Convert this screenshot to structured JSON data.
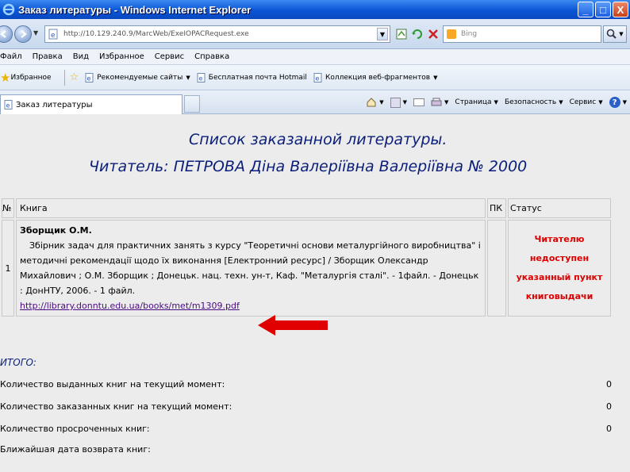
{
  "window": {
    "title": "Заказ литературы - Windows Internet Explorer",
    "buttons": {
      "minimize": "_",
      "maximize": "□",
      "close": "X"
    }
  },
  "address_bar": {
    "url": "http://10.129.240.9/MarcWeb/ExeIOPACRequest.exe",
    "search_placeholder": "Bing"
  },
  "menu": [
    "Файл",
    "Правка",
    "Вид",
    "Избранное",
    "Сервис",
    "Справка"
  ],
  "favorites": {
    "label": "Избранное",
    "items": [
      "Рекомендуемые сайты",
      "Бесплатная почта Hotmail",
      "Коллекция веб-фрагментов"
    ]
  },
  "tab": {
    "label": "Заказ литературы"
  },
  "command_bar": {
    "page": "Страница",
    "safety": "Безопасность",
    "tools": "Сервис"
  },
  "content": {
    "heading1": "Список заказанной литературы.",
    "heading2": "Читатель: ПЕТРОВА Діна Валеріївна Валеріївна   № 2000",
    "table": {
      "headers": {
        "num": "№",
        "book": "Книга",
        "pk": "ПК",
        "status": "Статус"
      },
      "rows": [
        {
          "num": "1",
          "author": "Зборщик О.М.",
          "description": "Збірник задач для практичних занять з курсу \"Теоретичні основи металургійного виробництва\" і методичні рекомендації щодо їх виконання [Електронний ресурс] / Зборщик Олександр Михайлович ; О.М. Зборщик ; Донецьк. нац. техн. ун-т, Каф. \"Металургія сталі\". - 1файл. - Донецьк : ДонНТУ, 2006. - 1 файл.",
          "link": "http://library.donntu.edu.ua/books/met/m1309.pdf",
          "pk": "",
          "status": "Читателю недоступен указанный пункт книговыдачи"
        }
      ]
    },
    "summary_title": "ИТОГО:",
    "summary": [
      {
        "label": "Количество выданных книг на текущий момент:",
        "value": "0"
      },
      {
        "label": "Количество заказанных книг на текущий момент:",
        "value": "0"
      },
      {
        "label": "Количество просроченных книг:",
        "value": "0"
      },
      {
        "label": "Ближайшая дата возврата книг:",
        "value": ""
      }
    ]
  },
  "colors": {
    "heading": "#0b1f7a",
    "status_red": "#e00000",
    "link": "#4b0a84",
    "arrow": "#e00000",
    "titlebar": "#0a55d6"
  }
}
